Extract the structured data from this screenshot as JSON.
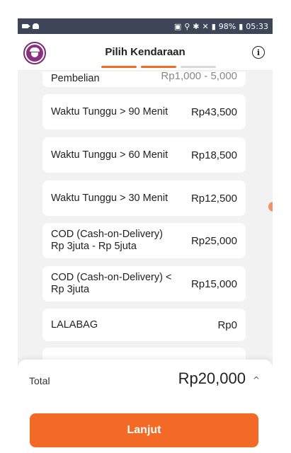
{
  "status_bar": {
    "battery": "98%",
    "time": "05:33"
  },
  "header": {
    "title": "Pilih Kendaraan",
    "info_icon": "info-icon",
    "avatar_icon": "driver-avatar-icon"
  },
  "progress": {
    "steps_total": 3,
    "steps_done": 2
  },
  "items": [
    {
      "label": "Pembelian",
      "amount": "Rp1,000 - 5,000"
    },
    {
      "label": "Waktu Tunggu > 90 Menit",
      "amount": "Rp43,500"
    },
    {
      "label": "Waktu Tunggu > 60 Menit",
      "amount": "Rp18,500"
    },
    {
      "label": "Waktu Tunggu > 30 Menit",
      "amount": "Rp12,500"
    },
    {
      "label": "COD (Cash-on-Delivery) Rp 3juta - Rp 5juta",
      "amount": "Rp25,000"
    },
    {
      "label": "COD (Cash-on-Delivery) < Rp 3juta",
      "amount": "Rp15,000"
    },
    {
      "label": "LALABAG",
      "amount": "Rp0"
    }
  ],
  "total": {
    "label": "Total",
    "amount": "Rp20,000",
    "toggle_icon": "chevron-up-icon"
  },
  "primary_button": {
    "label": "Lanjut"
  },
  "colors": {
    "accent": "#f26a25",
    "brand": "#8b2f80",
    "status_bar": "#3d4657",
    "background": "#f2f2f2"
  }
}
